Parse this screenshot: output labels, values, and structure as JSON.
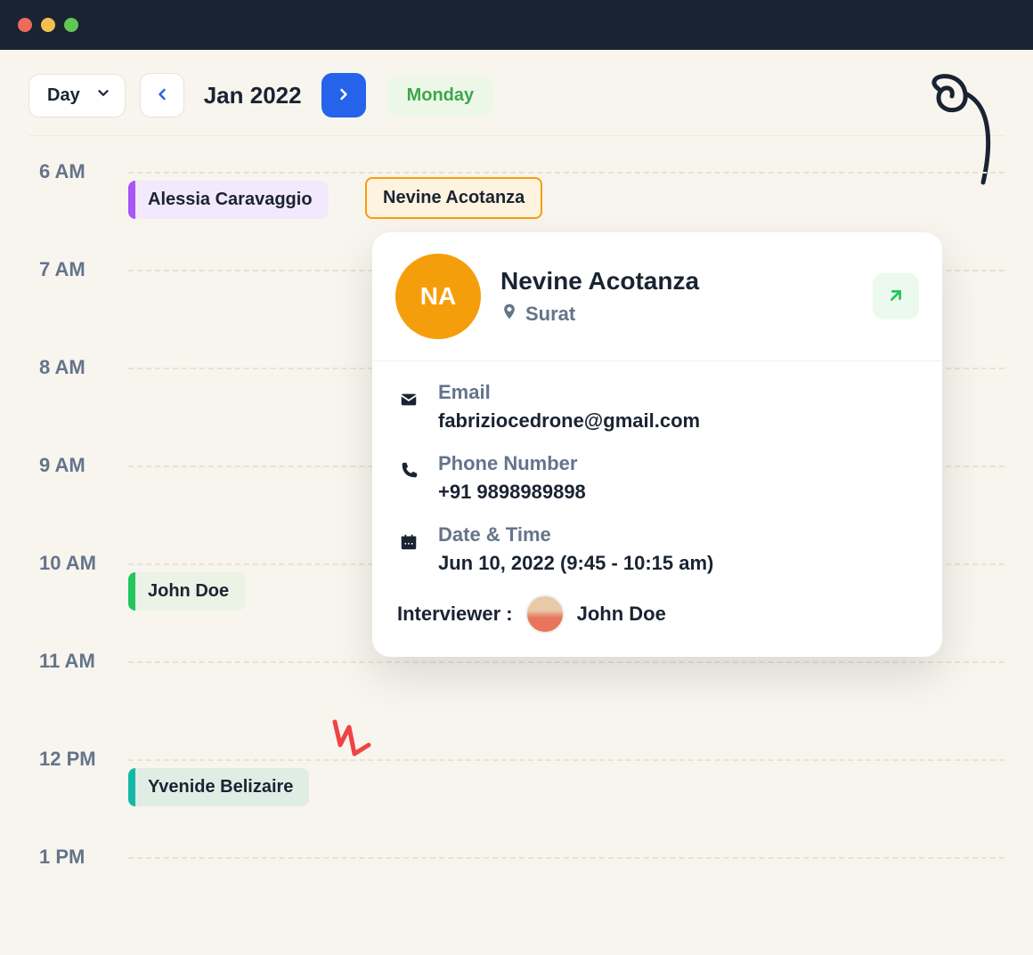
{
  "toolbar": {
    "view": "Day",
    "month": "Jan 2022",
    "day_name": "Monday"
  },
  "hours": [
    "6 AM",
    "7 AM",
    "8 AM",
    "9 AM",
    "10 AM",
    "11 AM",
    "12 PM",
    "1 PM"
  ],
  "events": {
    "e1": {
      "name": "Alessia Caravaggio"
    },
    "e2": {
      "name": "Nevine Acotanza"
    },
    "e3": {
      "name": "John Doe"
    },
    "e4": {
      "name": "Yvenide Belizaire"
    }
  },
  "popover": {
    "initials": "NA",
    "name": "Nevine Acotanza",
    "location": "Surat",
    "email_label": "Email",
    "email": "fabriziocedrone@gmail.com",
    "phone_label": "Phone Number",
    "phone": "+91 9898989898",
    "datetime_label": "Date & Time",
    "datetime": "Jun 10, 2022 (9:45 - 10:15 am)",
    "interviewer_label": "Interviewer :",
    "interviewer": "John Doe"
  }
}
